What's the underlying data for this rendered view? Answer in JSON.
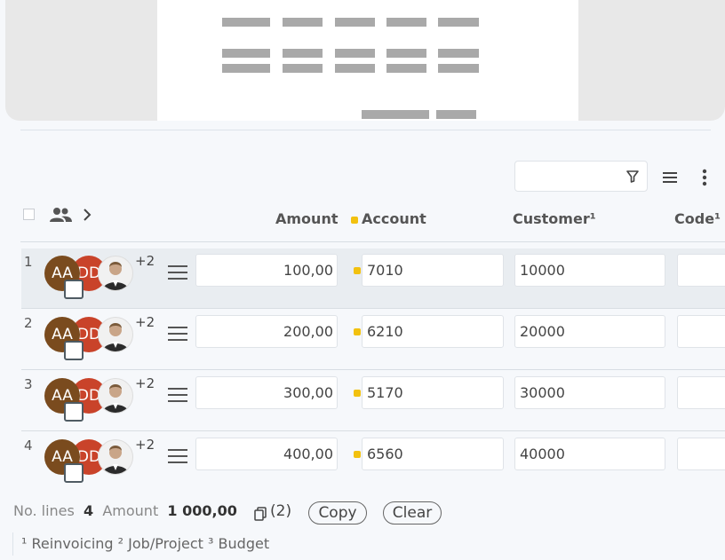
{
  "table": {
    "headers": {
      "amount": "Amount",
      "account": "Account",
      "customer": "Customer¹",
      "code": "Code¹"
    },
    "rows": [
      {
        "num": "1",
        "avatar_1": "AA",
        "avatar_2": "DD",
        "more_count": "+2",
        "amount": "100,00",
        "account": "7010",
        "customer": "10000",
        "code": ""
      },
      {
        "num": "2",
        "avatar_1": "AA",
        "avatar_2": "DD",
        "more_count": "+2",
        "amount": "200,00",
        "account": "6210",
        "customer": "20000",
        "code": ""
      },
      {
        "num": "3",
        "avatar_1": "AA",
        "avatar_2": "DD",
        "more_count": "+2",
        "amount": "300,00",
        "account": "5170",
        "customer": "30000",
        "code": ""
      },
      {
        "num": "4",
        "avatar_1": "AA",
        "avatar_2": "DD",
        "more_count": "+2",
        "amount": "400,00",
        "account": "6560",
        "customer": "40000",
        "code": ""
      }
    ]
  },
  "footer": {
    "lines_label": "No. lines",
    "lines_value": "4",
    "amount_label": "Amount",
    "amount_value": "1 000,00",
    "copies_count": "(2)",
    "copy_button": "Copy",
    "clear_button": "Clear",
    "notes": "¹ Reinvoicing ² Job/Project ³ Budget"
  },
  "colors": {
    "accent_dot": "#f2c10f",
    "avatar_aa": "#7a4b1e",
    "avatar_dd": "#c9432a"
  },
  "icons": [
    "filter-icon",
    "menu-icon",
    "kebab-icon",
    "people-icon",
    "chevron-right-icon",
    "drag-handle-icon",
    "copy-icon"
  ]
}
